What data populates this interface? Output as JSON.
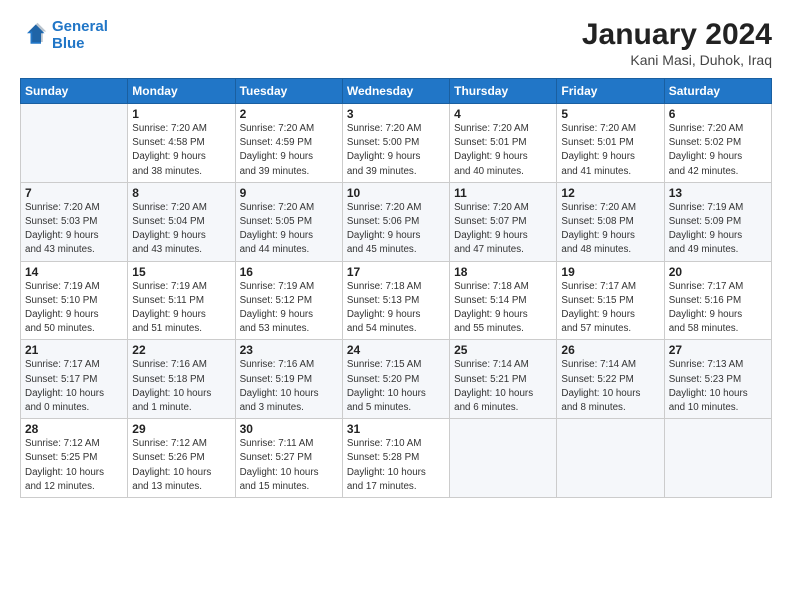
{
  "logo": {
    "line1": "General",
    "line2": "Blue"
  },
  "title": "January 2024",
  "subtitle": "Kani Masi, Duhok, Iraq",
  "days_of_week": [
    "Sunday",
    "Monday",
    "Tuesday",
    "Wednesday",
    "Thursday",
    "Friday",
    "Saturday"
  ],
  "weeks": [
    [
      {
        "day": "",
        "info": ""
      },
      {
        "day": "1",
        "info": "Sunrise: 7:20 AM\nSunset: 4:58 PM\nDaylight: 9 hours\nand 38 minutes."
      },
      {
        "day": "2",
        "info": "Sunrise: 7:20 AM\nSunset: 4:59 PM\nDaylight: 9 hours\nand 39 minutes."
      },
      {
        "day": "3",
        "info": "Sunrise: 7:20 AM\nSunset: 5:00 PM\nDaylight: 9 hours\nand 39 minutes."
      },
      {
        "day": "4",
        "info": "Sunrise: 7:20 AM\nSunset: 5:01 PM\nDaylight: 9 hours\nand 40 minutes."
      },
      {
        "day": "5",
        "info": "Sunrise: 7:20 AM\nSunset: 5:01 PM\nDaylight: 9 hours\nand 41 minutes."
      },
      {
        "day": "6",
        "info": "Sunrise: 7:20 AM\nSunset: 5:02 PM\nDaylight: 9 hours\nand 42 minutes."
      }
    ],
    [
      {
        "day": "7",
        "info": "Sunrise: 7:20 AM\nSunset: 5:03 PM\nDaylight: 9 hours\nand 43 minutes."
      },
      {
        "day": "8",
        "info": "Sunrise: 7:20 AM\nSunset: 5:04 PM\nDaylight: 9 hours\nand 43 minutes."
      },
      {
        "day": "9",
        "info": "Sunrise: 7:20 AM\nSunset: 5:05 PM\nDaylight: 9 hours\nand 44 minutes."
      },
      {
        "day": "10",
        "info": "Sunrise: 7:20 AM\nSunset: 5:06 PM\nDaylight: 9 hours\nand 45 minutes."
      },
      {
        "day": "11",
        "info": "Sunrise: 7:20 AM\nSunset: 5:07 PM\nDaylight: 9 hours\nand 47 minutes."
      },
      {
        "day": "12",
        "info": "Sunrise: 7:20 AM\nSunset: 5:08 PM\nDaylight: 9 hours\nand 48 minutes."
      },
      {
        "day": "13",
        "info": "Sunrise: 7:19 AM\nSunset: 5:09 PM\nDaylight: 9 hours\nand 49 minutes."
      }
    ],
    [
      {
        "day": "14",
        "info": "Sunrise: 7:19 AM\nSunset: 5:10 PM\nDaylight: 9 hours\nand 50 minutes."
      },
      {
        "day": "15",
        "info": "Sunrise: 7:19 AM\nSunset: 5:11 PM\nDaylight: 9 hours\nand 51 minutes."
      },
      {
        "day": "16",
        "info": "Sunrise: 7:19 AM\nSunset: 5:12 PM\nDaylight: 9 hours\nand 53 minutes."
      },
      {
        "day": "17",
        "info": "Sunrise: 7:18 AM\nSunset: 5:13 PM\nDaylight: 9 hours\nand 54 minutes."
      },
      {
        "day": "18",
        "info": "Sunrise: 7:18 AM\nSunset: 5:14 PM\nDaylight: 9 hours\nand 55 minutes."
      },
      {
        "day": "19",
        "info": "Sunrise: 7:17 AM\nSunset: 5:15 PM\nDaylight: 9 hours\nand 57 minutes."
      },
      {
        "day": "20",
        "info": "Sunrise: 7:17 AM\nSunset: 5:16 PM\nDaylight: 9 hours\nand 58 minutes."
      }
    ],
    [
      {
        "day": "21",
        "info": "Sunrise: 7:17 AM\nSunset: 5:17 PM\nDaylight: 10 hours\nand 0 minutes."
      },
      {
        "day": "22",
        "info": "Sunrise: 7:16 AM\nSunset: 5:18 PM\nDaylight: 10 hours\nand 1 minute."
      },
      {
        "day": "23",
        "info": "Sunrise: 7:16 AM\nSunset: 5:19 PM\nDaylight: 10 hours\nand 3 minutes."
      },
      {
        "day": "24",
        "info": "Sunrise: 7:15 AM\nSunset: 5:20 PM\nDaylight: 10 hours\nand 5 minutes."
      },
      {
        "day": "25",
        "info": "Sunrise: 7:14 AM\nSunset: 5:21 PM\nDaylight: 10 hours\nand 6 minutes."
      },
      {
        "day": "26",
        "info": "Sunrise: 7:14 AM\nSunset: 5:22 PM\nDaylight: 10 hours\nand 8 minutes."
      },
      {
        "day": "27",
        "info": "Sunrise: 7:13 AM\nSunset: 5:23 PM\nDaylight: 10 hours\nand 10 minutes."
      }
    ],
    [
      {
        "day": "28",
        "info": "Sunrise: 7:12 AM\nSunset: 5:25 PM\nDaylight: 10 hours\nand 12 minutes."
      },
      {
        "day": "29",
        "info": "Sunrise: 7:12 AM\nSunset: 5:26 PM\nDaylight: 10 hours\nand 13 minutes."
      },
      {
        "day": "30",
        "info": "Sunrise: 7:11 AM\nSunset: 5:27 PM\nDaylight: 10 hours\nand 15 minutes."
      },
      {
        "day": "31",
        "info": "Sunrise: 7:10 AM\nSunset: 5:28 PM\nDaylight: 10 hours\nand 17 minutes."
      },
      {
        "day": "",
        "info": ""
      },
      {
        "day": "",
        "info": ""
      },
      {
        "day": "",
        "info": ""
      }
    ]
  ]
}
